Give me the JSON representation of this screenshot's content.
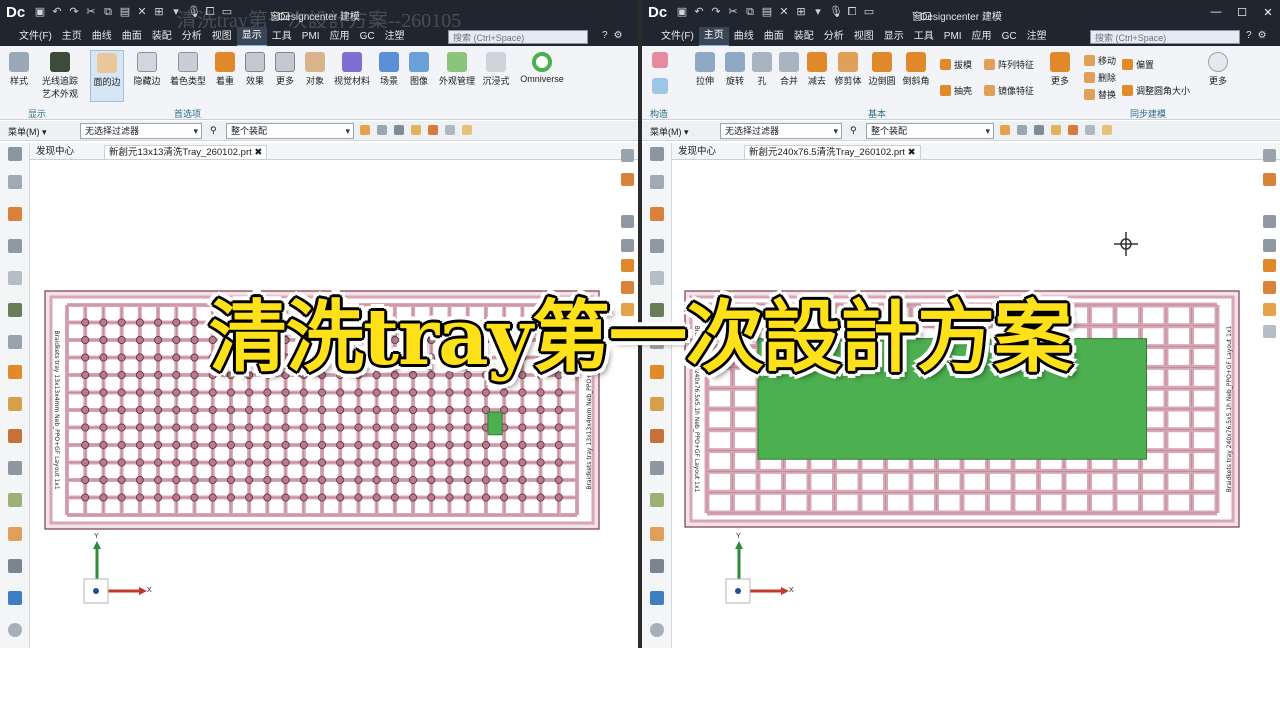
{
  "left": {
    "app_logo": "Dc",
    "window_menu": "窗口",
    "title": "Designcenter 建模",
    "ghost_title": "清洗tray第一次設計方案--260105",
    "menu": [
      "文件(F)",
      "主页",
      "曲线",
      "曲面",
      "装配",
      "分析",
      "视图",
      "显示",
      "工具",
      "PMI",
      "应用",
      "GC",
      "注塑"
    ],
    "active_menu": "显示",
    "search_placeholder": "搜索 (Ctrl+Space)",
    "ribbon": {
      "buttons": [
        "样式",
        "光线追踪\n艺术外观",
        "面的边",
        "隐藏边",
        "着色类型",
        "着重",
        "效果",
        "更多",
        "对象",
        "视觉材料",
        "场景",
        "图像",
        "外观管理",
        "沉浸式",
        "Omniverse"
      ],
      "groups": [
        "显示",
        "首选项"
      ]
    },
    "selbar": {
      "menu": "菜单(M) ▾",
      "filter": "无选择过滤器",
      "scope": "整个装配"
    },
    "tabs": [
      "发现中心",
      "新創元13x13清洗Tray_260102.prt"
    ],
    "tray_side_text_left": "Braidkets tray 13x13x4mm  Neb_PPO+GF  Layout 1x1",
    "tray_side_text_right": "Braidkets tray 13x13x4mm  Neb_PPO+GF  Layout 1x1",
    "axis_x": "X",
    "axis_y": "Y"
  },
  "right": {
    "app_logo": "Dc",
    "window_menu": "窗口",
    "title": "Designcenter 建模",
    "menu": [
      "文件(F)",
      "主页",
      "曲线",
      "曲面",
      "装配",
      "分析",
      "视图",
      "显示",
      "工具",
      "PMI",
      "应用",
      "GC",
      "注塑"
    ],
    "active_menu": "主页",
    "search_placeholder": "搜索 (Ctrl+Space)",
    "ribbon": {
      "left_buttons": [
        "拉伸",
        "旋转",
        "孔",
        "合并",
        "减去",
        "修剪体",
        "边倒圆",
        "倒斜角"
      ],
      "small_buttons": [
        "拔模",
        "抽壳",
        "阵列特征",
        "镜像特征"
      ],
      "more_label": "更多",
      "sync_buttons": [
        "移动",
        "删除",
        "替换",
        "偏置",
        "调整圆角大小"
      ],
      "more_label2": "更多",
      "groups": [
        "构造",
        "基本",
        "同步建模"
      ]
    },
    "selbar": {
      "menu": "菜单(M) ▾",
      "filter": "无选择过滤器",
      "scope": "整个装配"
    },
    "tabs": [
      "发现中心",
      "新創元240x76.5清洗Tray_260102.prt"
    ],
    "tray_side_text_left": "Braidkets tray 240x76.5x5.1h  Neb_PPO+GF  Layout 1x1",
    "tray_side_text_right": "Braidkets tray 240x76.5x5.1h  Neb_PPO+GF  Layout 1x1",
    "axis_x": "X",
    "axis_y": "Y"
  },
  "caption": "清洗tray第一次設計方案",
  "colors": {
    "chrome_dark": "#1f2630",
    "tray_pink": "#d9a6b4",
    "tray_outline": "#7a3a4c",
    "highlight_green": "#4caf50",
    "caption_yellow": "#ffe11a"
  }
}
